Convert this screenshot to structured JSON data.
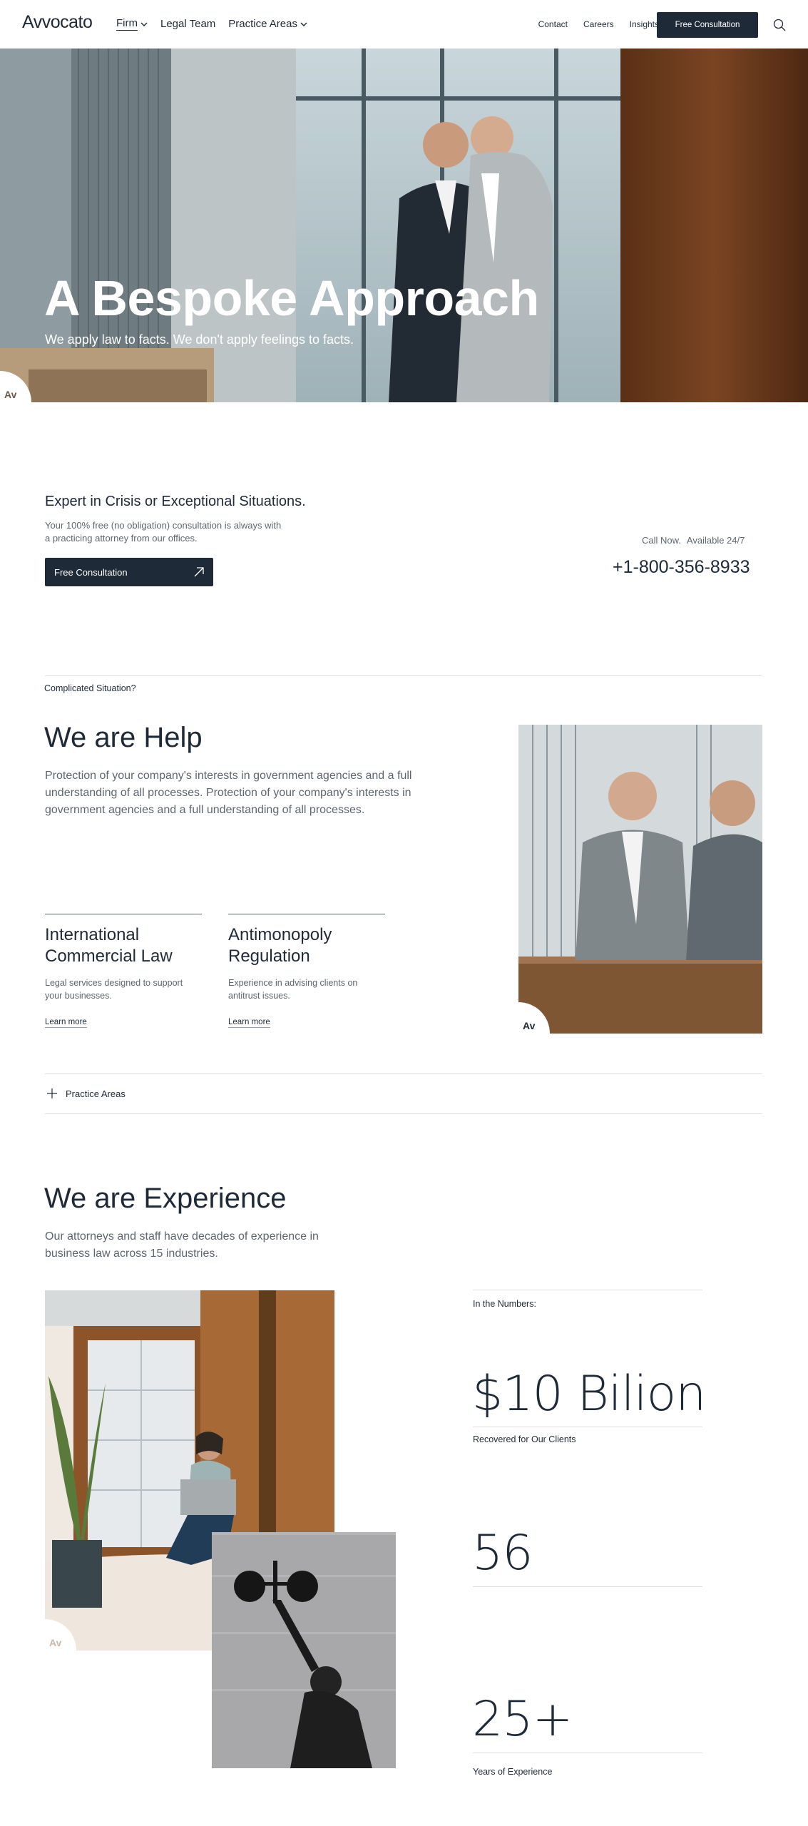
{
  "nav": {
    "logo": "Avvocato",
    "main": [
      {
        "label": "Firm",
        "dropdown": true
      },
      {
        "label": "Legal Team",
        "dropdown": false
      },
      {
        "label": "Practice Areas",
        "dropdown": true
      }
    ],
    "secondary": [
      "Contact",
      "Careers",
      "Insights"
    ],
    "cta": "Free Consultation",
    "search_icon": "search-icon"
  },
  "hero": {
    "title": "A Bespoke Approach",
    "subtitle": "We apply law to facts. We don't apply feelings to facts.",
    "badge": "Av"
  },
  "expert": {
    "title": "Expert in Crisis or Exceptional Situations.",
    "description": "Your 100% free (no obligation) consultation is always with a practicing attorney from our offices.",
    "button": "Free Consultation",
    "call_label": "Call Now.",
    "availability": "Available 24/7",
    "phone": "+1-800-356-8933"
  },
  "help": {
    "eyebrow": "Complicated Situation?",
    "title": "We are Help",
    "description": "Protection of your company's interests in government agencies and a full understanding of all processes. Protection of your company's interests in government agencies and a full understanding of all processes.",
    "cards": [
      {
        "title": "International Commercial Law",
        "description": "Legal services designed to support your businesses.",
        "link": "Learn more"
      },
      {
        "title": "Antimonopoly Regulation",
        "description": "Experience in advising clients on antitrust issues.",
        "link": "Learn more"
      }
    ],
    "badge": "Av"
  },
  "practice_areas": {
    "label": "Practice Areas"
  },
  "experience": {
    "title": "We are Experience",
    "description": "Our attorneys and staff have decades of experience in business law across 15 industries.",
    "badge": "Av",
    "numbers_eyebrow": "In the Numbers:",
    "stats": [
      {
        "value": "$10 Bilion",
        "caption": "Recovered for Our Clients"
      },
      {
        "value": "56",
        "caption": ""
      },
      {
        "value": "25+",
        "caption": "Years of Experience"
      }
    ]
  },
  "colors": {
    "primary": "#1e2a38",
    "muted_text": "#5d6670",
    "divider": "#dcdfe2",
    "white": "#ffffff"
  }
}
